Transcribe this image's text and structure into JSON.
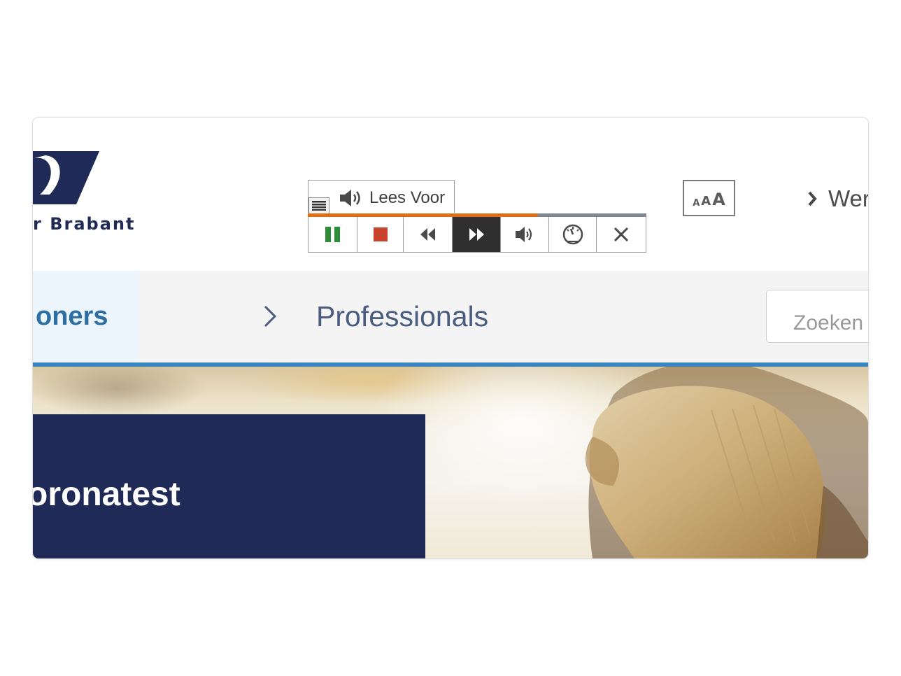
{
  "header": {
    "logo_text": "r Brabant",
    "accent_color": "#1f2a56"
  },
  "readspeaker": {
    "label": "Lees Voor",
    "progress": 0.68,
    "buttons": [
      {
        "icon": "pause-icon",
        "color": "#2e8b3a"
      },
      {
        "icon": "stop-icon",
        "color": "#c8432e"
      },
      {
        "icon": "rewind-icon",
        "color": "#4a4a4a"
      },
      {
        "icon": "fast-forward-icon",
        "color": "#ffffff",
        "active": true
      },
      {
        "icon": "volume-icon",
        "color": "#4a4a4a"
      },
      {
        "icon": "speed-icon",
        "color": "#4a4a4a"
      },
      {
        "icon": "close-icon",
        "color": "#4a4a4a"
      }
    ],
    "progress_color": "#e46c12"
  },
  "text_size": {
    "small": "A",
    "medium": "A",
    "large": "A"
  },
  "top_link": {
    "label": "Wer"
  },
  "nav": {
    "active_label": "oners",
    "item_label": "Professionals",
    "active_color": "#2d6fa3",
    "underline_color": "#3a84bf"
  },
  "search": {
    "placeholder": "Zoeken"
  },
  "hero": {
    "title": "oronatest"
  }
}
